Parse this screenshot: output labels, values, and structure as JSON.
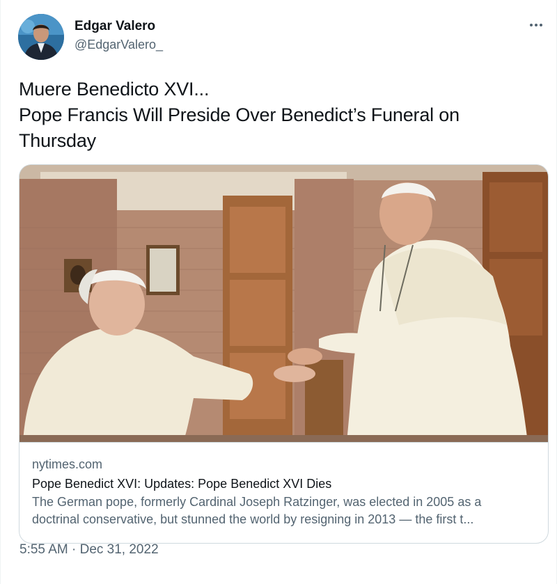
{
  "author": {
    "display_name": "Edgar Valero",
    "handle": "@EdgarValero_"
  },
  "more_menu": {
    "icon": "more-horizontal-icon"
  },
  "tweet": {
    "lines": [
      "Muere Benedicto XVI...",
      "Pope Francis Will Preside Over Benedict’s Funeral on",
      "Thursday"
    ]
  },
  "card": {
    "domain": "nytimes.com",
    "title": "Pope Benedict XVI: Updates: Pope Benedict XVI Dies",
    "description_line1": "The German pope, formerly Cardinal Joseph Ratzinger, was elected in 2005 as a",
    "description_line2": "doctrinal conservative, but stunned the world by resigning in 2013 — the first t..."
  },
  "meta": {
    "time": "5:55 AM",
    "separator": "·",
    "date": "Dec 31, 2022"
  },
  "colors": {
    "text_primary": "#0f1419",
    "text_secondary": "#536471",
    "border": "#cfd9de"
  }
}
